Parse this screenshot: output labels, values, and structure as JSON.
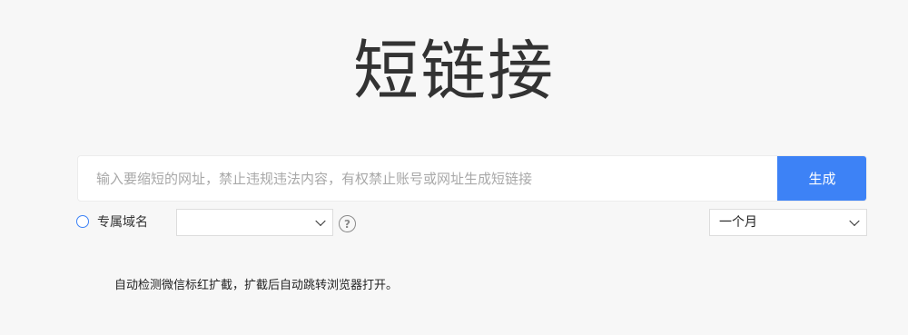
{
  "page": {
    "title": "短链接"
  },
  "search": {
    "placeholder": "输入要缩短的网址，禁止违规违法内容，有权禁止账号或网址生成短链接",
    "value": "",
    "generate_label": "生成"
  },
  "options": {
    "custom_domain_label": "专属域名",
    "custom_domain_selected": "",
    "help_icon": "question-circle-icon",
    "expiry_selected": "一个月"
  },
  "notice": {
    "text": "自动检测微信标红扩截，扩截后自动跳转浏览器打开。"
  },
  "colors": {
    "accent": "#3d82f6",
    "background": "#f7f7f7"
  }
}
